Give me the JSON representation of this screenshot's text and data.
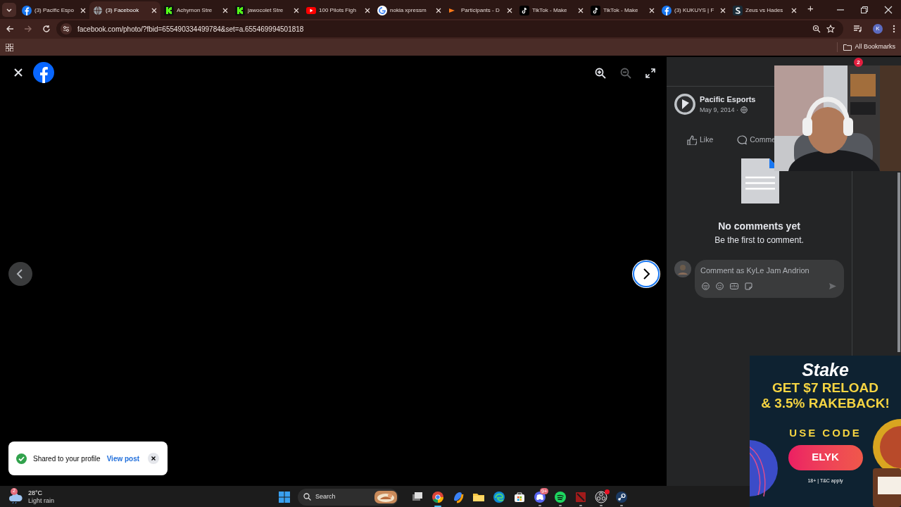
{
  "browser": {
    "tabs": [
      {
        "title": "(3) Pacific Espo",
        "kind": "facebook",
        "selected": false
      },
      {
        "title": "(3) Facebook",
        "kind": "globe",
        "selected": true
      },
      {
        "title": "Achymon Stre",
        "kind": "kick",
        "selected": false
      },
      {
        "title": "jawocolet Stre",
        "kind": "kick",
        "selected": false
      },
      {
        "title": "100 Pilots Figh",
        "kind": "youtube",
        "selected": false
      },
      {
        "title": "nokia xpressm",
        "kind": "google",
        "selected": false
      },
      {
        "title": "Participants - D",
        "kind": "bracket",
        "selected": false
      },
      {
        "title": "TikTok - Make",
        "kind": "tiktok",
        "selected": false
      },
      {
        "title": "TikTok - Make",
        "kind": "tiktok",
        "selected": false
      },
      {
        "title": "(3) KUKUYS | F",
        "kind": "facebook",
        "selected": false
      },
      {
        "title": "Zeus vs Hades",
        "kind": "stake",
        "selected": false
      }
    ],
    "new_tab": "+",
    "address": "facebook.com/photo/?fbid=655490334499784&set=a.655469994501818",
    "profile_initial": "K",
    "bookmarks": "All Bookmarks"
  },
  "viewer": {
    "zoom_in": {
      "disabled": false
    },
    "zoom_out": {
      "disabled": true
    }
  },
  "panel": {
    "notification_count": "2",
    "author": "Pacific Esports",
    "date": "May 9, 2014 ·",
    "actions": [
      {
        "kind": "like",
        "label": "Like"
      },
      {
        "kind": "comment",
        "label": "Comme"
      }
    ],
    "empty_title": "No comments yet",
    "empty_hint": "Be the first to comment.",
    "composer_placeholder": "Comment as KyLe Jam Andrion"
  },
  "toast": {
    "message": "Shared to your profile",
    "link": "View post"
  },
  "ad": {
    "brand": "Stake",
    "headline": [
      "GET $7 RELOAD",
      "& 3.5% RAKEBACK!"
    ],
    "code_label": "USE CODE",
    "code": "ELYK",
    "fine_print": "18+ | T&C apply"
  },
  "taskbar": {
    "weather": {
      "badge": "2",
      "temperature": "28°C",
      "condition": "Light rain"
    },
    "search": "Search",
    "apps": [
      {
        "kind": "taskview",
        "active": false,
        "running": false,
        "alert": false
      },
      {
        "kind": "chrome",
        "active": true,
        "running": true,
        "alert": false
      },
      {
        "kind": "copilot",
        "active": false,
        "running": false,
        "alert": false
      },
      {
        "kind": "files",
        "active": false,
        "running": false,
        "alert": false
      },
      {
        "kind": "edge",
        "active": false,
        "running": false,
        "alert": false
      },
      {
        "kind": "store",
        "active": false,
        "running": false,
        "alert": false
      },
      {
        "kind": "discord",
        "active": false,
        "running": true,
        "alert": false,
        "badge": "9+"
      },
      {
        "kind": "spotify",
        "active": false,
        "running": true,
        "alert": false
      },
      {
        "kind": "dota",
        "active": false,
        "running": true,
        "alert": false
      },
      {
        "kind": "obs",
        "active": false,
        "running": true,
        "alert": true
      },
      {
        "kind": "steam",
        "active": false,
        "running": true,
        "alert": false
      }
    ]
  }
}
